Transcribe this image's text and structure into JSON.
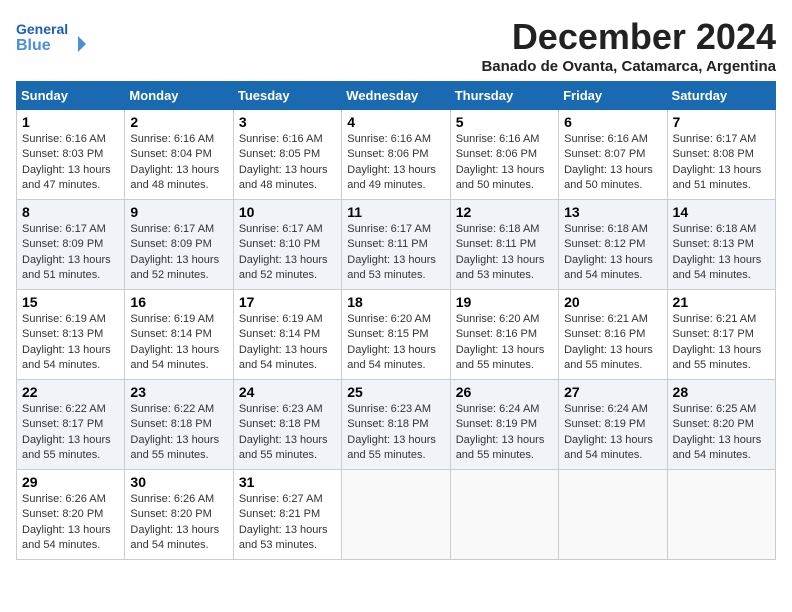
{
  "header": {
    "logo_line1": "General",
    "logo_line2": "Blue",
    "month_title": "December 2024",
    "subtitle": "Banado de Ovanta, Catamarca, Argentina"
  },
  "weekdays": [
    "Sunday",
    "Monday",
    "Tuesday",
    "Wednesday",
    "Thursday",
    "Friday",
    "Saturday"
  ],
  "weeks": [
    [
      {
        "day": "1",
        "sunrise": "6:16 AM",
        "sunset": "8:03 PM",
        "daylight": "13 hours and 47 minutes."
      },
      {
        "day": "2",
        "sunrise": "6:16 AM",
        "sunset": "8:04 PM",
        "daylight": "13 hours and 48 minutes."
      },
      {
        "day": "3",
        "sunrise": "6:16 AM",
        "sunset": "8:05 PM",
        "daylight": "13 hours and 48 minutes."
      },
      {
        "day": "4",
        "sunrise": "6:16 AM",
        "sunset": "8:06 PM",
        "daylight": "13 hours and 49 minutes."
      },
      {
        "day": "5",
        "sunrise": "6:16 AM",
        "sunset": "8:06 PM",
        "daylight": "13 hours and 50 minutes."
      },
      {
        "day": "6",
        "sunrise": "6:16 AM",
        "sunset": "8:07 PM",
        "daylight": "13 hours and 50 minutes."
      },
      {
        "day": "7",
        "sunrise": "6:17 AM",
        "sunset": "8:08 PM",
        "daylight": "13 hours and 51 minutes."
      }
    ],
    [
      {
        "day": "8",
        "sunrise": "6:17 AM",
        "sunset": "8:09 PM",
        "daylight": "13 hours and 51 minutes."
      },
      {
        "day": "9",
        "sunrise": "6:17 AM",
        "sunset": "8:09 PM",
        "daylight": "13 hours and 52 minutes."
      },
      {
        "day": "10",
        "sunrise": "6:17 AM",
        "sunset": "8:10 PM",
        "daylight": "13 hours and 52 minutes."
      },
      {
        "day": "11",
        "sunrise": "6:17 AM",
        "sunset": "8:11 PM",
        "daylight": "13 hours and 53 minutes."
      },
      {
        "day": "12",
        "sunrise": "6:18 AM",
        "sunset": "8:11 PM",
        "daylight": "13 hours and 53 minutes."
      },
      {
        "day": "13",
        "sunrise": "6:18 AM",
        "sunset": "8:12 PM",
        "daylight": "13 hours and 54 minutes."
      },
      {
        "day": "14",
        "sunrise": "6:18 AM",
        "sunset": "8:13 PM",
        "daylight": "13 hours and 54 minutes."
      }
    ],
    [
      {
        "day": "15",
        "sunrise": "6:19 AM",
        "sunset": "8:13 PM",
        "daylight": "13 hours and 54 minutes."
      },
      {
        "day": "16",
        "sunrise": "6:19 AM",
        "sunset": "8:14 PM",
        "daylight": "13 hours and 54 minutes."
      },
      {
        "day": "17",
        "sunrise": "6:19 AM",
        "sunset": "8:14 PM",
        "daylight": "13 hours and 54 minutes."
      },
      {
        "day": "18",
        "sunrise": "6:20 AM",
        "sunset": "8:15 PM",
        "daylight": "13 hours and 54 minutes."
      },
      {
        "day": "19",
        "sunrise": "6:20 AM",
        "sunset": "8:16 PM",
        "daylight": "13 hours and 55 minutes."
      },
      {
        "day": "20",
        "sunrise": "6:21 AM",
        "sunset": "8:16 PM",
        "daylight": "13 hours and 55 minutes."
      },
      {
        "day": "21",
        "sunrise": "6:21 AM",
        "sunset": "8:17 PM",
        "daylight": "13 hours and 55 minutes."
      }
    ],
    [
      {
        "day": "22",
        "sunrise": "6:22 AM",
        "sunset": "8:17 PM",
        "daylight": "13 hours and 55 minutes."
      },
      {
        "day": "23",
        "sunrise": "6:22 AM",
        "sunset": "8:18 PM",
        "daylight": "13 hours and 55 minutes."
      },
      {
        "day": "24",
        "sunrise": "6:23 AM",
        "sunset": "8:18 PM",
        "daylight": "13 hours and 55 minutes."
      },
      {
        "day": "25",
        "sunrise": "6:23 AM",
        "sunset": "8:18 PM",
        "daylight": "13 hours and 55 minutes."
      },
      {
        "day": "26",
        "sunrise": "6:24 AM",
        "sunset": "8:19 PM",
        "daylight": "13 hours and 55 minutes."
      },
      {
        "day": "27",
        "sunrise": "6:24 AM",
        "sunset": "8:19 PM",
        "daylight": "13 hours and 54 minutes."
      },
      {
        "day": "28",
        "sunrise": "6:25 AM",
        "sunset": "8:20 PM",
        "daylight": "13 hours and 54 minutes."
      }
    ],
    [
      {
        "day": "29",
        "sunrise": "6:26 AM",
        "sunset": "8:20 PM",
        "daylight": "13 hours and 54 minutes."
      },
      {
        "day": "30",
        "sunrise": "6:26 AM",
        "sunset": "8:20 PM",
        "daylight": "13 hours and 54 minutes."
      },
      {
        "day": "31",
        "sunrise": "6:27 AM",
        "sunset": "8:21 PM",
        "daylight": "13 hours and 53 minutes."
      },
      null,
      null,
      null,
      null
    ]
  ]
}
